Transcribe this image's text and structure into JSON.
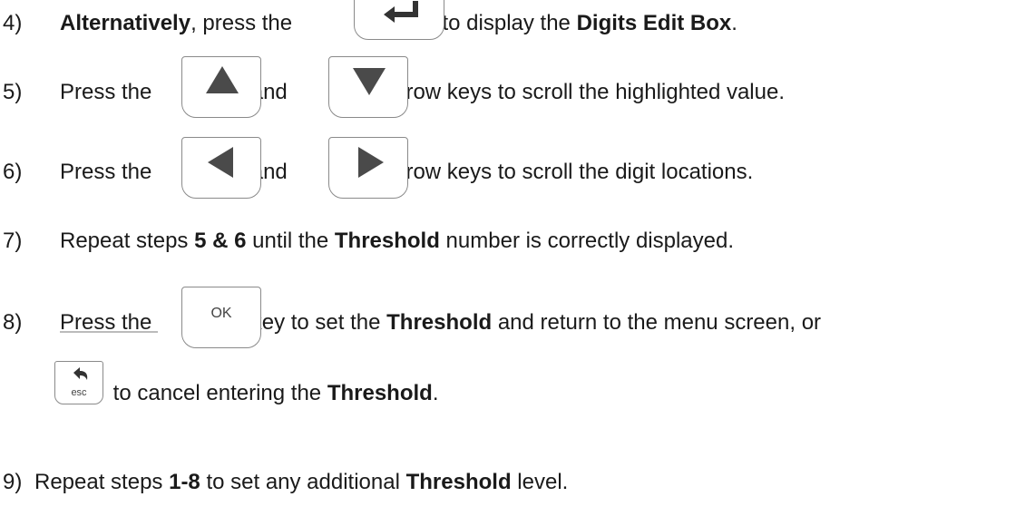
{
  "steps": [
    {
      "num": "4)",
      "t1": "Alternatively",
      "t2": ", press the ",
      "t3": " key to display the ",
      "t4": "Digits Edit Box",
      "t5": "."
    },
    {
      "num": "5)",
      "t1": "Press the ",
      "t2": " and ",
      "t3": " arrow keys to scroll the highlighted value."
    },
    {
      "num": "6)",
      "t1": "Press the ",
      "t2": " and ",
      "t3": " arrow keys to scroll the digit locations."
    },
    {
      "num": "7)",
      "t1": "Repeat steps ",
      "t2": "5 & 6",
      "t3": " until the ",
      "t4": "Threshold",
      "t5": " number is correctly displayed."
    },
    {
      "num": "8)",
      "t1": "Press the ",
      "t2": " key to set the ",
      "t3": "Threshold",
      "t4": " and return to the menu screen, or",
      "t5": " to cancel entering the ",
      "t6": "Threshold",
      "t7": "."
    },
    {
      "num": "9)",
      "t1": "Repeat steps ",
      "t2": "1-8",
      "t3": " to set any additional ",
      "t4": "Threshold",
      "t5": " level."
    }
  ],
  "keys": {
    "ok_label": "OK",
    "esc_label": "esc",
    "icons": [
      "enter-key-icon",
      "up-arrow-icon",
      "down-arrow-icon",
      "left-arrow-icon",
      "right-arrow-icon",
      "esc-back-icon"
    ]
  }
}
